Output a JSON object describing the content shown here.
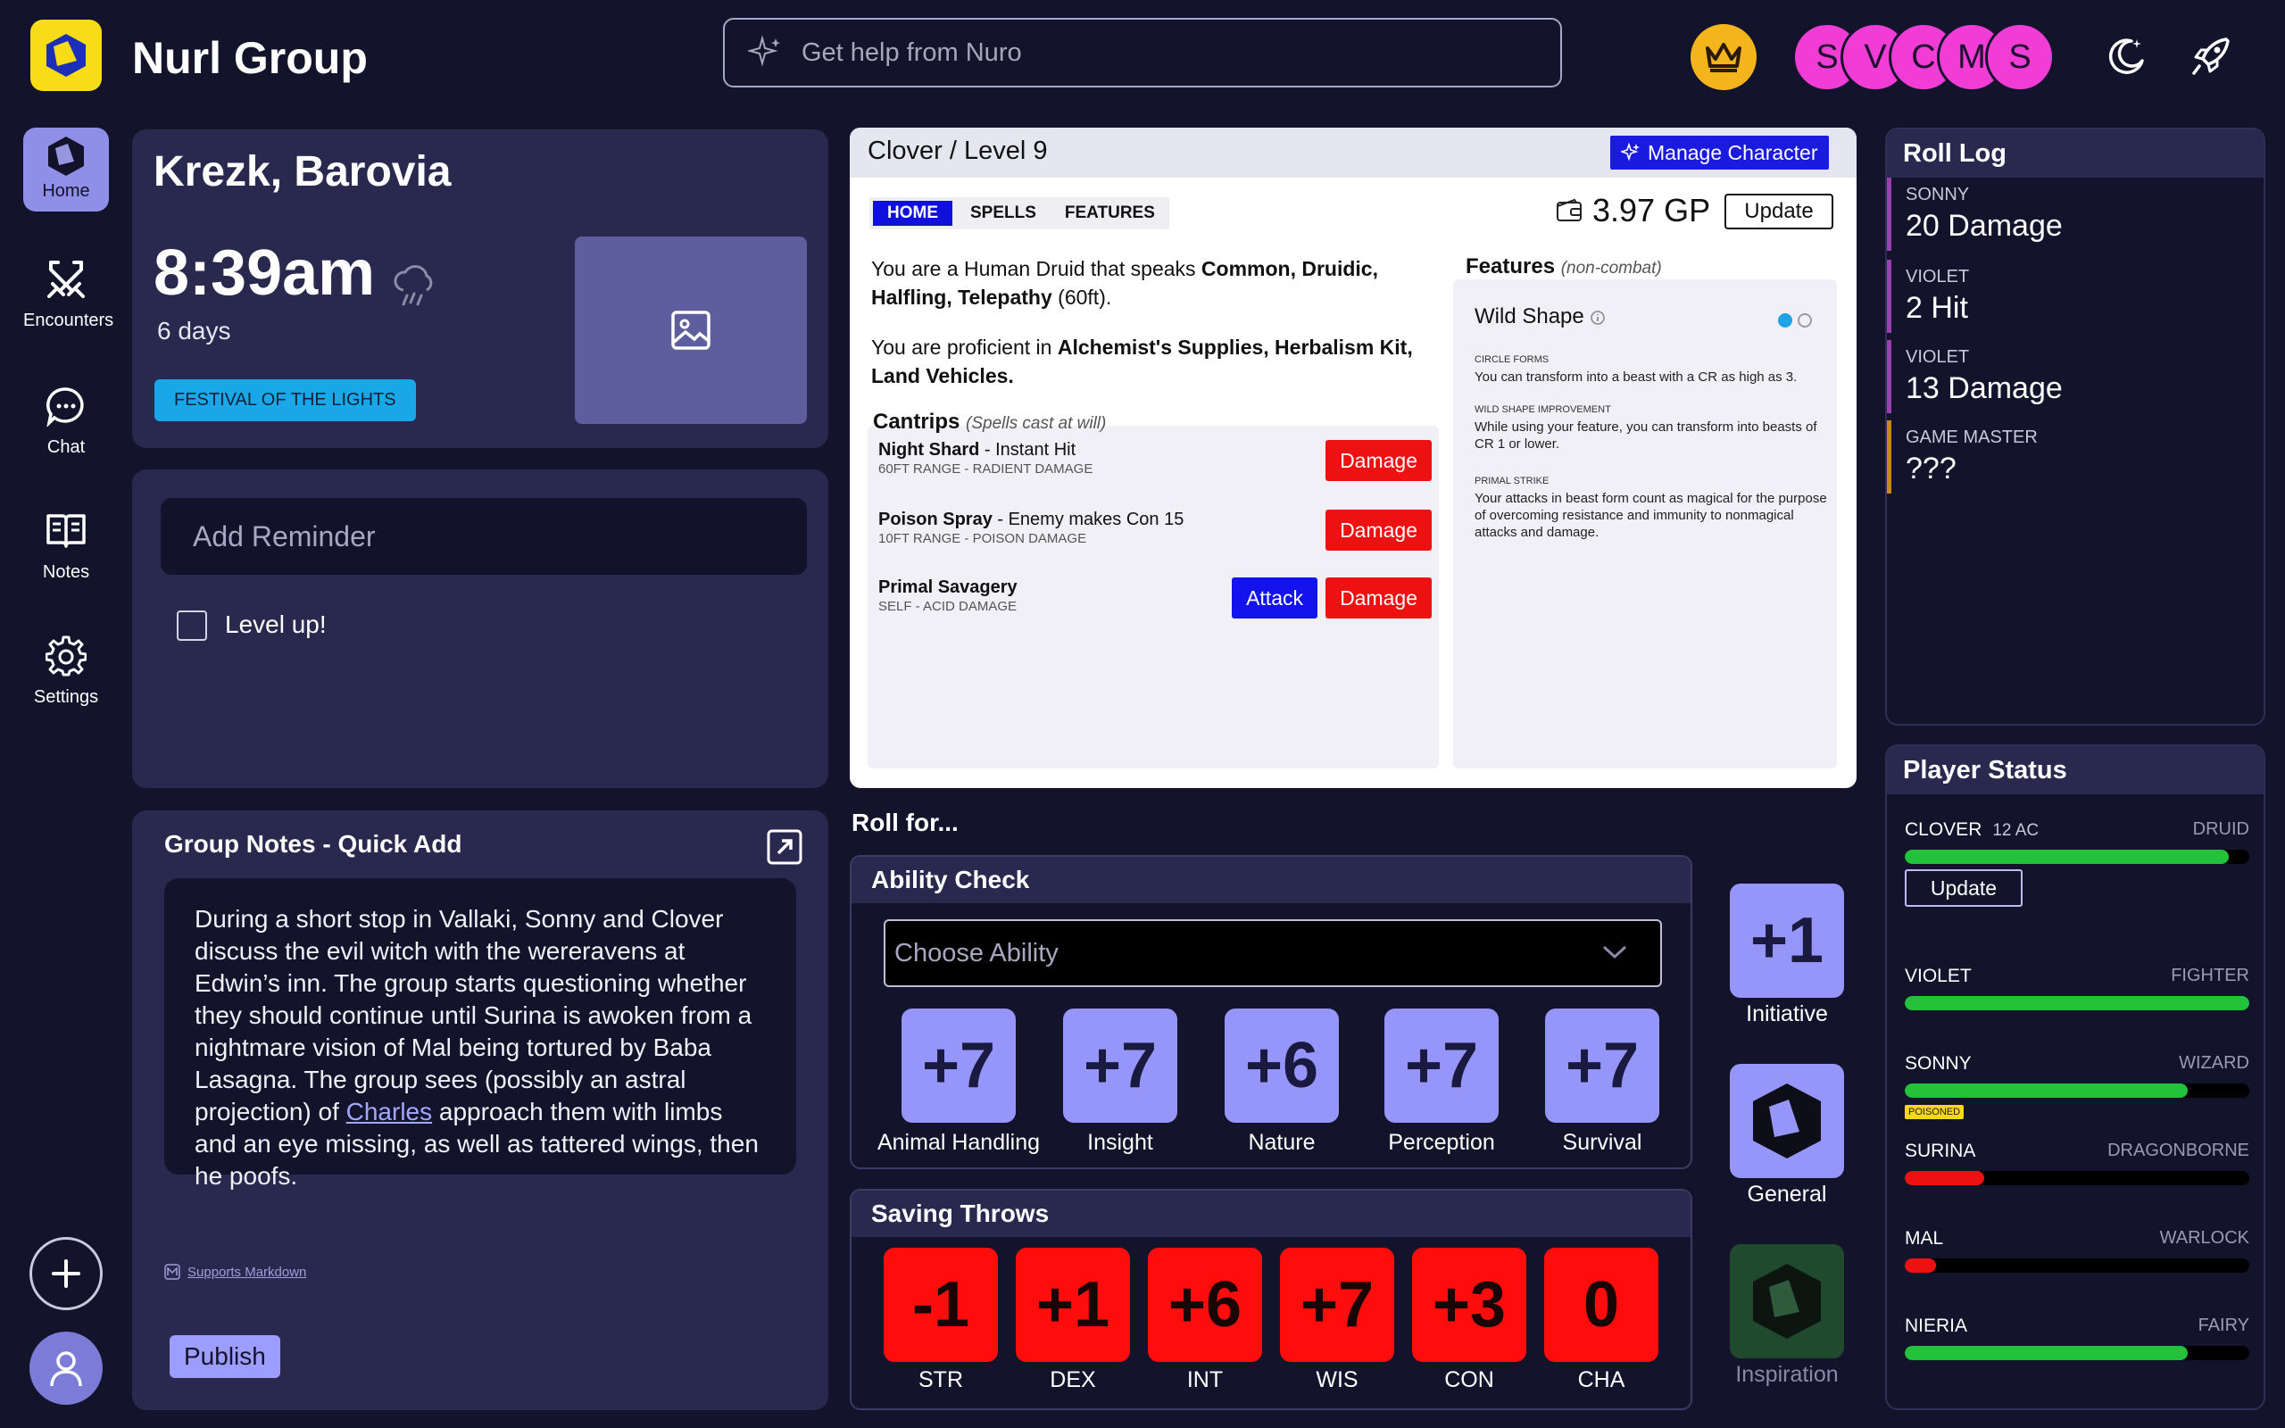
{
  "app": {
    "title": "Nurl Group",
    "search_placeholder": "Get help from Nuro"
  },
  "party_avatars": [
    "S",
    "V",
    "C",
    "M",
    "S"
  ],
  "nav": [
    {
      "label": "Home",
      "icon": "home-cube-icon"
    },
    {
      "label": "Encounters",
      "icon": "crossed-swords-icon"
    },
    {
      "label": "Chat",
      "icon": "chat-bubble-icon"
    },
    {
      "label": "Notes",
      "icon": "open-book-icon"
    },
    {
      "label": "Settings",
      "icon": "gear-icon"
    }
  ],
  "location": {
    "name": "Krezk, Barovia",
    "time": "8:39am",
    "days": "6 days",
    "event": "FESTIVAL OF THE LIGHTS"
  },
  "reminders": {
    "placeholder": "Add Reminder",
    "items": [
      {
        "label": "Level up!",
        "checked": false
      }
    ]
  },
  "notes": {
    "title": "Group Notes - Quick Add",
    "text_before": "During a short stop in Vallaki, Sonny and Clover discuss the evil witch with the wereravens at Edwin’s inn. The group starts questioning whether they should continue until Surina is awoken from a nightmare vision of Mal being tortured by Baba Lasagna. The group sees (possibly an astral projection) of ",
    "link": "Charles",
    "text_after": " approach them with limbs and an eye missing, as well as tattered wings, then he poofs.",
    "markdown": "Supports Markdown",
    "publish": "Publish"
  },
  "character": {
    "title": "Clover / Level 9",
    "manage": "Manage Character",
    "tabs": [
      "HOME",
      "SPELLS",
      "FEATURES"
    ],
    "gold": "3.97 GP",
    "update": "Update",
    "desc1_pre": "You are a Human Druid that speaks ",
    "desc1_bold": "Common, Druidic, Halfling, Telepathy",
    "desc1_post": " (60ft).",
    "desc2_pre": "You are proficient in ",
    "desc2_bold": "Alchemist's Supplies, Herbalism Kit, Land Vehicles.",
    "cantrips_title": "Cantrips",
    "cantrips_sub": "(Spells cast at will)",
    "cantrips": [
      {
        "name": "Night Shard",
        "effect": " - Instant Hit",
        "sub": "60FT RANGE - RADIENT DAMAGE",
        "buttons": [
          "Damage"
        ]
      },
      {
        "name": "Poison Spray",
        "effect": " - Enemy makes Con 15",
        "sub": "10FT RANGE - POISON DAMAGE",
        "buttons": [
          "Damage"
        ]
      },
      {
        "name": "Primal Savagery",
        "effect": "",
        "sub": "SELF - ACID DAMAGE",
        "buttons": [
          "Attack",
          "Damage"
        ]
      }
    ],
    "features_title": "Features",
    "features_sub": "(non-combat)",
    "feature_name": "Wild Shape",
    "feature_sections": [
      {
        "title": "CIRCLE FORMS",
        "text": "You can transform into a beast with a CR as high as 3."
      },
      {
        "title": "WILD SHAPE IMPROVEMENT",
        "text": "While using your feature, you can transform into beasts of CR 1 or lower."
      },
      {
        "title": "PRIMAL STRIKE",
        "text": "Your attacks in beast form count as magical for the purpose of overcoming resistance and immunity to nonmagical attacks and damage."
      }
    ]
  },
  "roll": {
    "title": "Roll for...",
    "ability_title": "Ability Check",
    "choose": "Choose Ability",
    "abilities": [
      {
        "value": "+7",
        "label": "Animal Handling"
      },
      {
        "value": "+7",
        "label": "Insight"
      },
      {
        "value": "+6",
        "label": "Nature"
      },
      {
        "value": "+7",
        "label": "Perception"
      },
      {
        "value": "+7",
        "label": "Survival"
      }
    ],
    "saves_title": "Saving Throws",
    "saves": [
      {
        "value": "-1",
        "label": "STR"
      },
      {
        "value": "+1",
        "label": "DEX"
      },
      {
        "value": "+6",
        "label": "INT"
      },
      {
        "value": "+7",
        "label": "WIS"
      },
      {
        "value": "+3",
        "label": "CON"
      },
      {
        "value": "0",
        "label": "CHA"
      }
    ],
    "initiative_value": "+1",
    "initiative": "Initiative",
    "general": "General",
    "inspiration": "Inspiration"
  },
  "roll_log": {
    "title": "Roll Log",
    "entries": [
      {
        "who": "SONNY",
        "what": "20 Damage"
      },
      {
        "who": "VIOLET",
        "what": "2 Hit"
      },
      {
        "who": "VIOLET",
        "what": "13 Damage"
      },
      {
        "who": "GAME MASTER",
        "what": "???"
      }
    ]
  },
  "player_status": {
    "title": "Player Status",
    "update": "Update",
    "players": [
      {
        "name": "CLOVER",
        "ac": "12 AC",
        "cls": "DRUID",
        "hp": 0.94,
        "color": "#22c23a"
      },
      {
        "name": "VIOLET",
        "ac": "",
        "cls": "FIGHTER",
        "hp": 1.0,
        "color": "#22c23a"
      },
      {
        "name": "SONNY",
        "ac": "",
        "cls": "WIZARD",
        "hp": 0.82,
        "color": "#22c23a",
        "condition": "POISONED"
      },
      {
        "name": "SURINA",
        "ac": "",
        "cls": "DRAGONBORNE",
        "hp": 0.23,
        "color": "#ee1111"
      },
      {
        "name": "MAL",
        "ac": "",
        "cls": "WARLOCK",
        "hp": 0.09,
        "color": "#ee1111"
      },
      {
        "name": "NIERIA",
        "ac": "",
        "cls": "FAIRY",
        "hp": 0.82,
        "color": "#22c23a"
      }
    ]
  }
}
